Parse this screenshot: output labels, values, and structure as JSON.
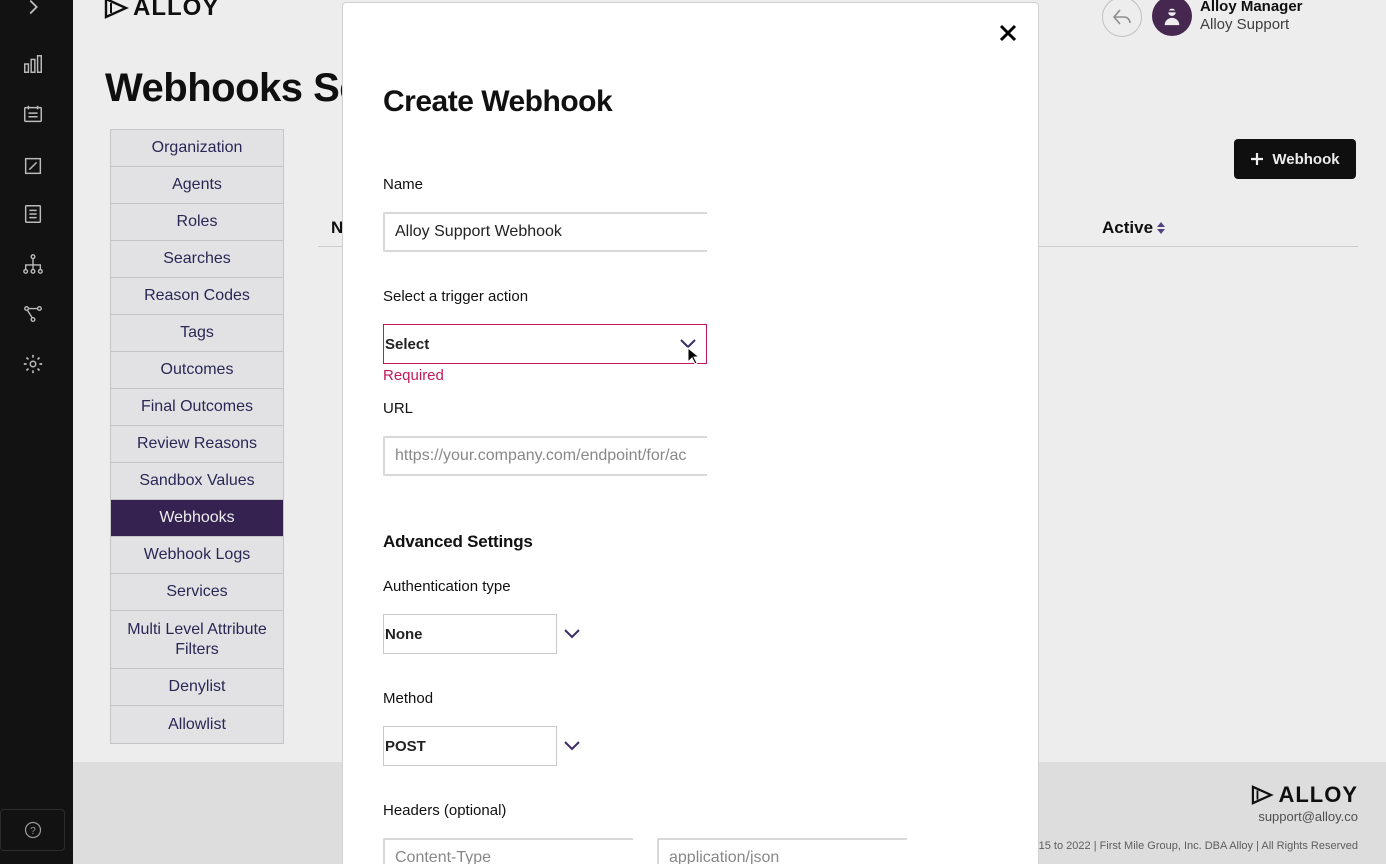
{
  "rail": {
    "icons": [
      "chevron-right-icon",
      "bar-chart-icon",
      "ticket-icon",
      "edit-icon",
      "document-icon",
      "hierarchy-icon",
      "flow-icon",
      "gear-icon",
      "help-icon"
    ],
    "help_label": "?"
  },
  "header": {
    "logo_text": "ALLOY",
    "user_name": "Alloy Manager",
    "user_org": "Alloy Support"
  },
  "page": {
    "title": "Webhooks Se",
    "add_button_label": "Webhook",
    "table_columns": {
      "name": "N",
      "active": "Active"
    }
  },
  "settings_nav": {
    "items": [
      {
        "label": "Organization"
      },
      {
        "label": "Agents"
      },
      {
        "label": "Roles"
      },
      {
        "label": "Searches"
      },
      {
        "label": "Reason Codes"
      },
      {
        "label": "Tags"
      },
      {
        "label": "Outcomes"
      },
      {
        "label": "Final Outcomes"
      },
      {
        "label": "Review Reasons"
      },
      {
        "label": "Sandbox Values"
      },
      {
        "label": "Webhooks",
        "active": true
      },
      {
        "label": "Webhook Logs"
      },
      {
        "label": "Services"
      },
      {
        "label": "Multi Level Attribute Filters",
        "tall": true
      },
      {
        "label": "Denylist"
      },
      {
        "label": "Allowlist"
      }
    ]
  },
  "footer": {
    "logo_text": "ALLOY",
    "email": "support@alloy.co",
    "copyright": "15 to 2022  |  First Mile Group, Inc. DBA Alloy  |  All Rights Reserved"
  },
  "modal": {
    "title": "Create Webhook",
    "close_label": "✕",
    "name_label": "Name",
    "name_value": "Alloy Support Webhook",
    "trigger_label": "Select a trigger action",
    "trigger_value": "Select",
    "trigger_error": "Required",
    "url_label": "URL",
    "url_placeholder": "https://your.company.com/endpoint/for/ac",
    "advanced_title": "Advanced Settings",
    "auth_label": "Authentication type",
    "auth_value": "None",
    "method_label": "Method",
    "method_value": "POST",
    "headers_label": "Headers (optional)",
    "header_key_placeholder": "Content-Type",
    "header_value_placeholder": "application/json"
  },
  "colors": {
    "rail_bg": "#121212",
    "nav_active": "#3a2558",
    "nav_text": "#2e2a5c",
    "error": "#c2185b",
    "chevron": "#3a2a6a"
  }
}
